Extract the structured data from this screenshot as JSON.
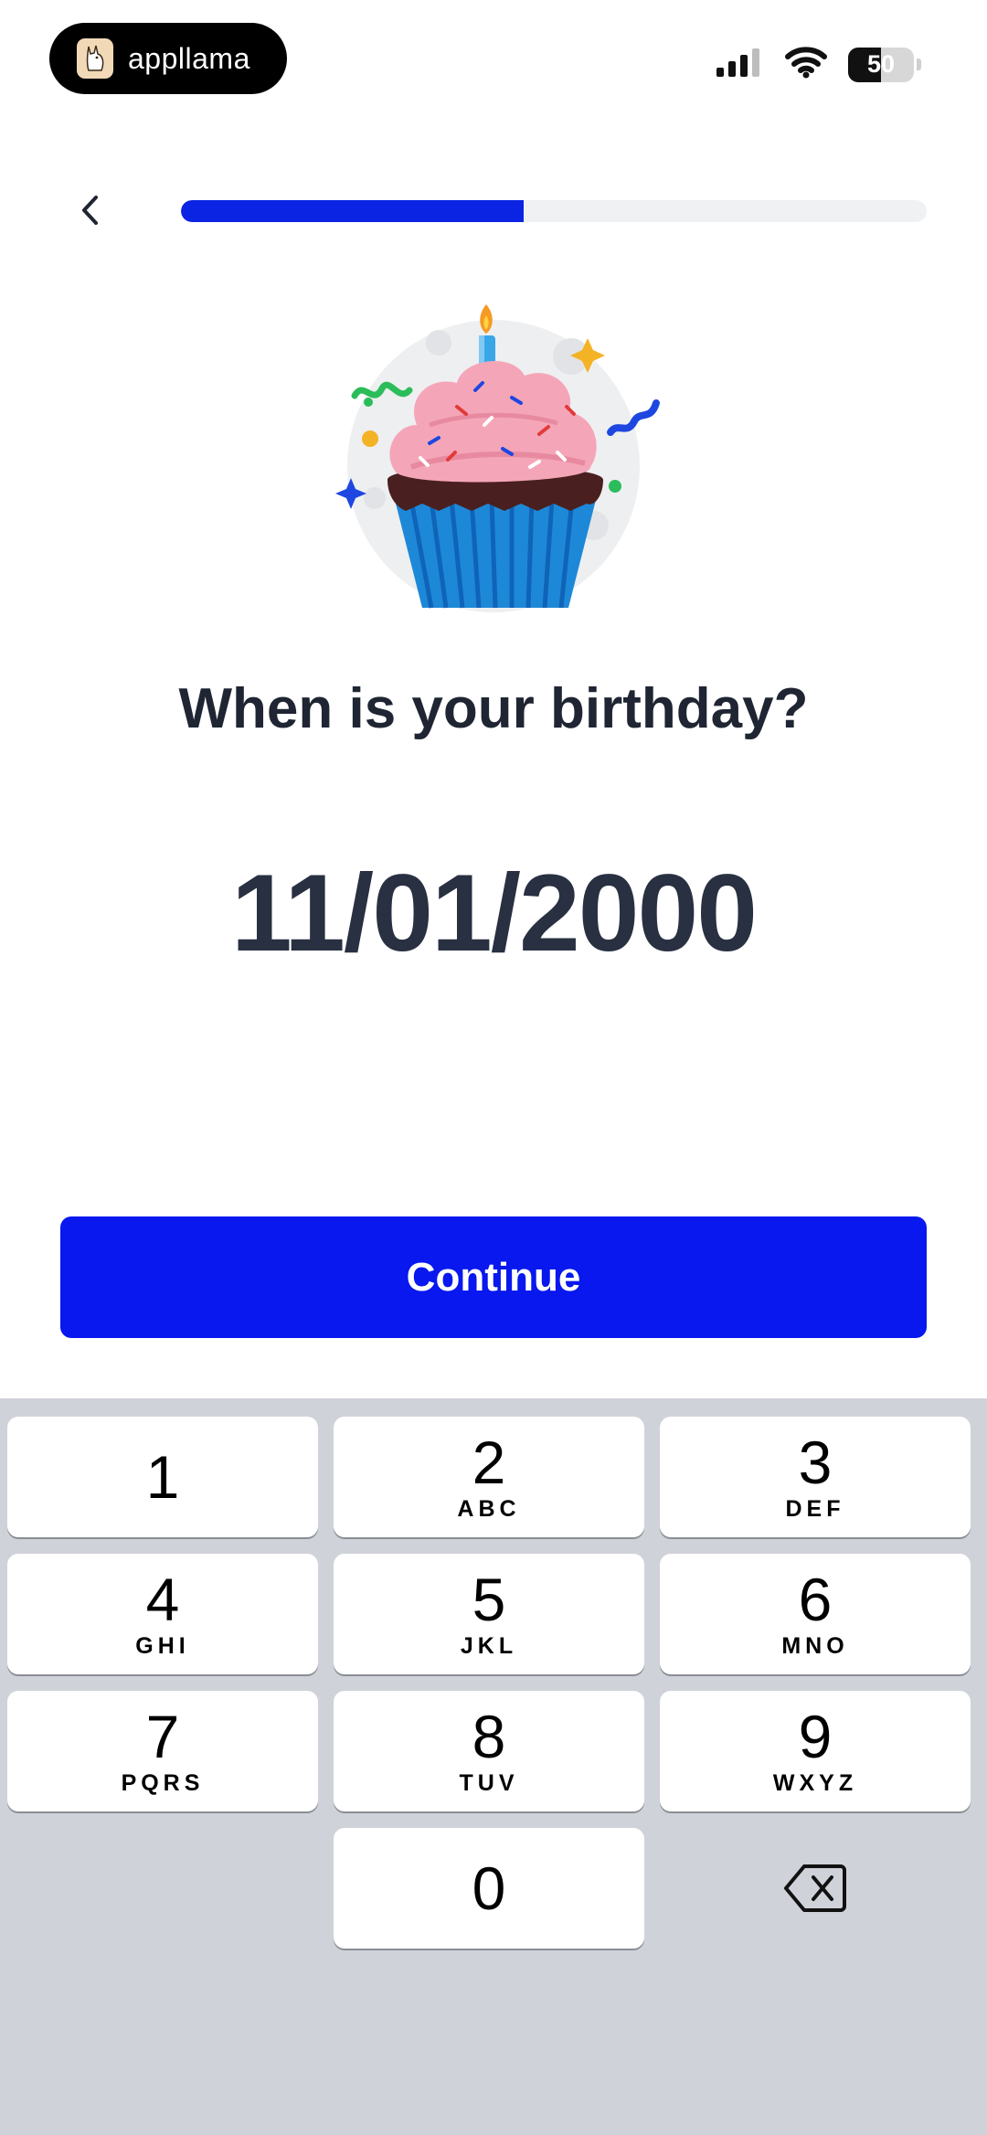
{
  "status_bar": {
    "app_name": "appllama",
    "battery_level": "50",
    "battery_fraction": 0.5
  },
  "onboarding": {
    "progress": 0.46,
    "question": "When is your birthday?",
    "birthday_value": "11/01/2000",
    "continue_label": "Continue"
  },
  "keypad": {
    "keys": [
      {
        "digit": "1",
        "letters": ""
      },
      {
        "digit": "2",
        "letters": "ABC"
      },
      {
        "digit": "3",
        "letters": "DEF"
      },
      {
        "digit": "4",
        "letters": "GHI"
      },
      {
        "digit": "5",
        "letters": "JKL"
      },
      {
        "digit": "6",
        "letters": "MNO"
      },
      {
        "digit": "7",
        "letters": "PQRS"
      },
      {
        "digit": "8",
        "letters": "TUV"
      },
      {
        "digit": "9",
        "letters": "WXYZ"
      },
      {
        "digit": "0",
        "letters": ""
      }
    ]
  },
  "colors": {
    "accent": "#0818ee",
    "progress": "#0b24e3",
    "keypad_bg": "#cfd2d8",
    "frosting": "#f4a6b8",
    "cupcake_liner": "#2a8fe0"
  },
  "icons": {
    "back": "chevron-left-icon",
    "delete": "backspace-icon",
    "signal": "cellular-signal-icon",
    "wifi": "wifi-icon",
    "battery": "battery-icon",
    "illustration": "cupcake-icon"
  }
}
